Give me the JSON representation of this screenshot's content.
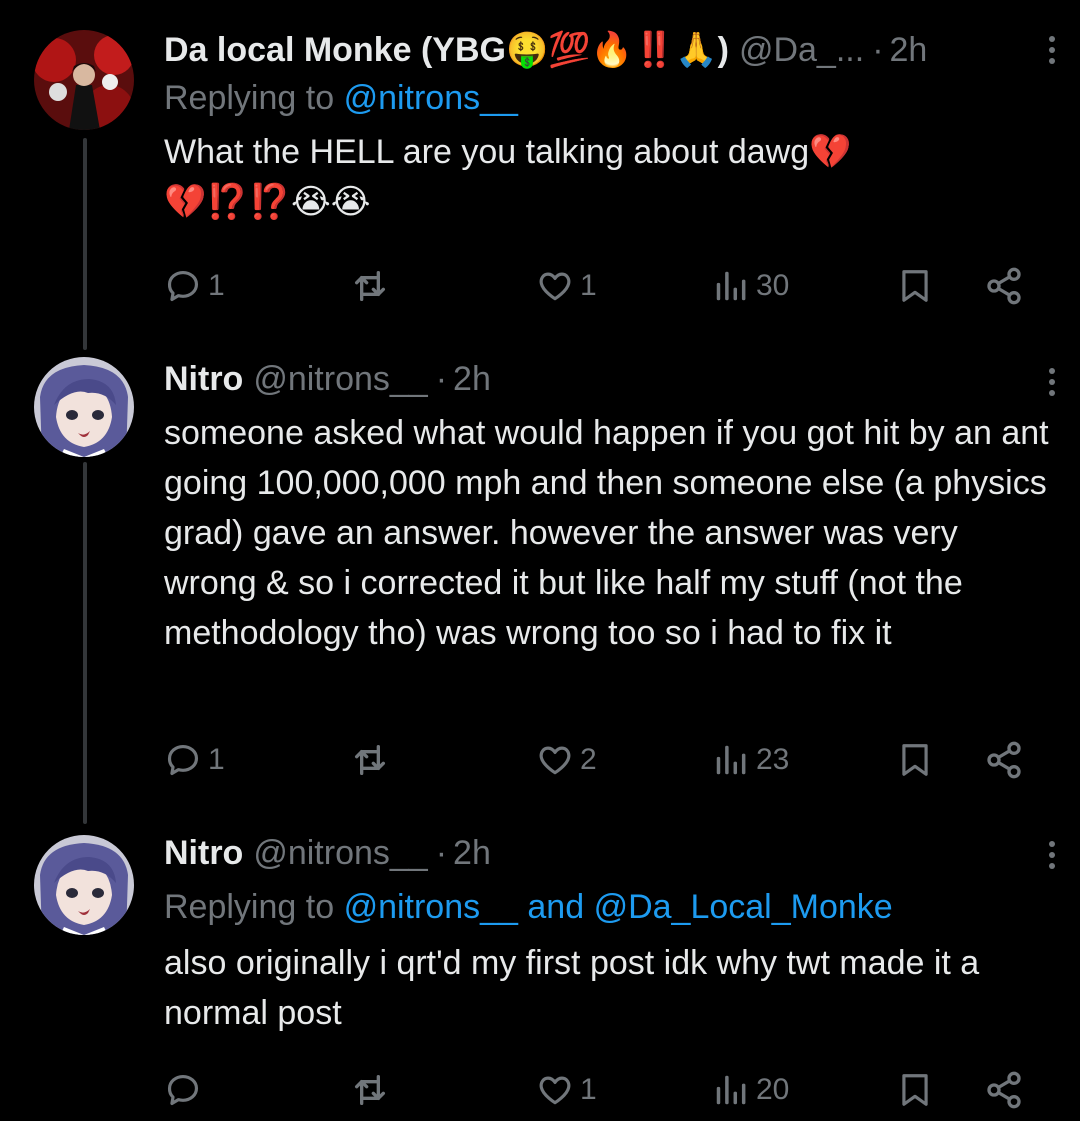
{
  "tweets": [
    {
      "display_name": "Da local Monke (YBG🤑💯🔥‼️🙏)",
      "handle": "@Da_...",
      "dot": "·",
      "time": "2h",
      "replying_label": "Replying to",
      "replying_mentions": "@nitrons__",
      "text": "What the HELL are you talking about dawg💔\n💔⁉️⁉️😭😭",
      "replies": "1",
      "reposts": "",
      "likes": "1",
      "views": "30"
    },
    {
      "display_name": "Nitro",
      "handle": "@nitrons__",
      "dot": "·",
      "time": "2h",
      "text": "someone asked what would happen if you got hit by an ant going 100,000,000 mph and then someone else (a physics grad) gave an answer. however the answer was very wrong & so i corrected it but like half my stuff (not the methodology tho) was wrong too so i had to fix it",
      "replies": "1",
      "reposts": "",
      "likes": "2",
      "views": "23"
    },
    {
      "display_name": "Nitro",
      "handle": "@nitrons__",
      "dot": "·",
      "time": "2h",
      "replying_label": "Replying to",
      "replying_mentions": "@nitrons__ and @Da_Local_Monke",
      "text": "also originally i qrt'd my first post idk why twt made it a normal post",
      "replies": "",
      "reposts": "",
      "likes": "1",
      "views": "20"
    }
  ],
  "icons": {
    "reply": "reply-icon",
    "repost": "repost-icon",
    "like": "heart-icon",
    "views": "views-icon",
    "bookmark": "bookmark-icon",
    "share": "share-icon",
    "more": "more-icon"
  },
  "colors": {
    "background": "#000000",
    "text": "#e7e9ea",
    "muted": "#71767b",
    "link": "#1d9bf0",
    "thread_line": "#333639"
  }
}
